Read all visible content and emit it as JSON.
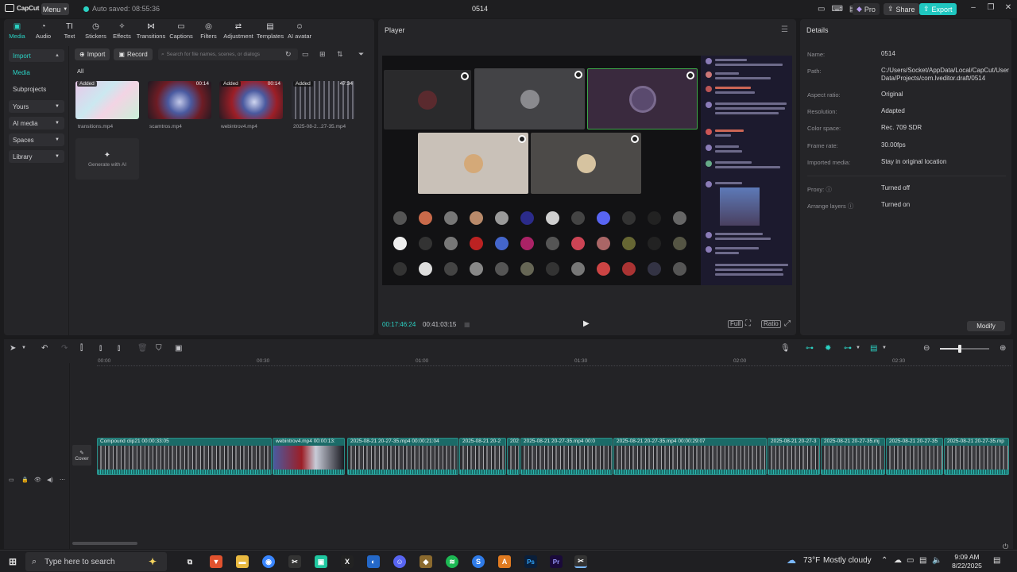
{
  "titlebar": {
    "logo_text": "CapCut",
    "menu_label": "Menu",
    "autosave": "Auto saved: 08:55:36",
    "project_title": "0514",
    "pro_label": "Pro",
    "share_label": "Share",
    "export_label": "Export"
  },
  "toolbar_tabs": [
    {
      "label": "Media",
      "icon": "▣"
    },
    {
      "label": "Audio",
      "icon": "◔"
    },
    {
      "label": "Text",
      "icon": "TI"
    },
    {
      "label": "Stickers",
      "icon": "◷"
    },
    {
      "label": "Effects",
      "icon": "✧"
    },
    {
      "label": "Transitions",
      "icon": "⋈"
    },
    {
      "label": "Captions",
      "icon": "▭"
    },
    {
      "label": "Filters",
      "icon": "◎"
    },
    {
      "label": "Adjustment",
      "icon": "⇄"
    },
    {
      "label": "Templates",
      "icon": "▤"
    },
    {
      "label": "AI avatar",
      "icon": "☺"
    }
  ],
  "sidebar": {
    "items": [
      "Import",
      "Media",
      "Subprojects",
      "Yours",
      "AI media",
      "Spaces",
      "Library"
    ]
  },
  "media": {
    "import_label": "Import",
    "record_label": "Record",
    "search_placeholder": "Search for file names, scenes, or dialogs",
    "all_label": "All",
    "generate_label": "Generate with AI",
    "items": [
      {
        "name": "transitions.mp4",
        "tag": "Added",
        "duration": ""
      },
      {
        "name": "scamtros.mp4",
        "tag": "",
        "duration": "00:14"
      },
      {
        "name": "webintrov4.mp4",
        "tag": "Added",
        "duration": "00:14"
      },
      {
        "name": "2025-08-2...27-35.mp4",
        "tag": "Added",
        "duration": "47:34"
      }
    ]
  },
  "player": {
    "title": "Player",
    "current_time": "00:17:46:24",
    "total_time": "00:41:03:15"
  },
  "details": {
    "title": "Details",
    "rows": [
      {
        "key": "Name:",
        "value": "0514"
      },
      {
        "key": "Path:",
        "value": "C:/Users/Socket/AppData/Local/CapCut/User Data/Projects/com.lveditor.draft/0514"
      },
      {
        "key": "Aspect ratio:",
        "value": "Original"
      },
      {
        "key": "Resolution:",
        "value": "Adapted"
      },
      {
        "key": "Color space:",
        "value": "Rec. 709 SDR"
      },
      {
        "key": "Frame rate:",
        "value": "30.00fps"
      },
      {
        "key": "Imported media:",
        "value": "Stay in original location"
      },
      {
        "key": "Proxy:",
        "value": "Turned off"
      },
      {
        "key": "Arrange layers",
        "value": "Turned on"
      }
    ],
    "modify_label": "Modify"
  },
  "timeline": {
    "ruler": [
      "00:00",
      "00:30",
      "01:00",
      "01:30",
      "02:00",
      "02:30"
    ],
    "cover_label": "Cover",
    "clips": [
      "Compound clip21   00:00:33:05",
      "webintrov4.mp4   00:00:13:",
      "2025-08-21 20-27-35.mp4   00:00:21:04",
      "2025-08-21 20-2",
      "2025",
      "2025-08-21 20-27-35.mp4   00:0",
      "2025-08-21 20-27-35.mp4   00:00:29:07",
      "2025-08-21 20-27-3",
      "2025-08-21 20-27-35.mj",
      "2025-08-21 20-27-35",
      "2025-08-21 20-27-35.mp"
    ]
  },
  "taskbar": {
    "search_placeholder": "Type here to search",
    "weather_temp": "73°F",
    "weather_desc": "Mostly cloudy",
    "time": "9:09 AM",
    "date": "8/22/2025"
  }
}
